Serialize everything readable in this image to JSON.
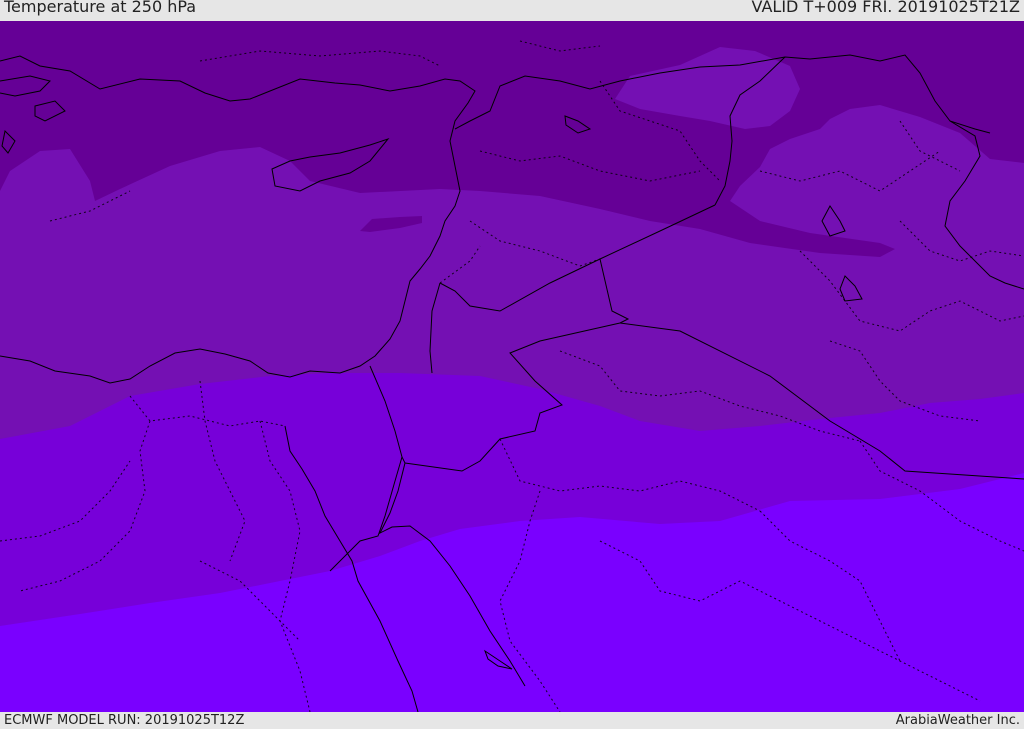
{
  "header": {
    "title": "Temperature at 250 hPa",
    "valid_time": "VALID T+009 FRI. 20191025T21Z"
  },
  "footer": {
    "model_run": "ECMWF MODEL RUN: 20191025T12Z",
    "credit": "ArabiaWeather Inc."
  },
  "colors": {
    "band_darkest": "#650096",
    "band_dark": "#7410b3",
    "band_mid": "#7700d9",
    "band_bright": "#7a00ff",
    "borders": "#000000"
  }
}
